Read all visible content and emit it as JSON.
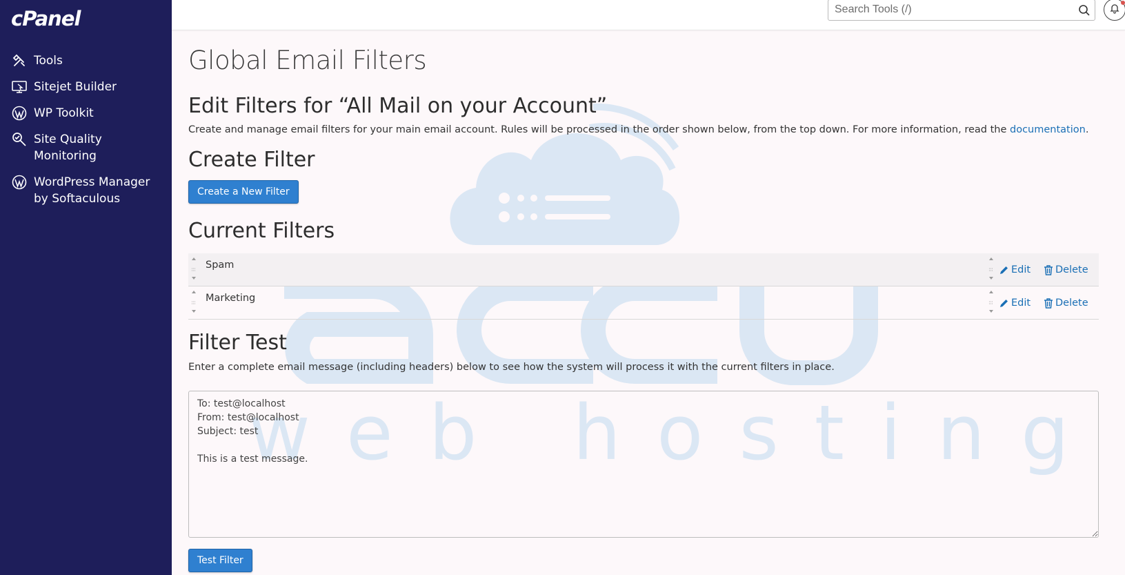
{
  "sidebar": {
    "logo": "cPanel",
    "items": [
      {
        "label": "Tools",
        "icon": "tools-icon"
      },
      {
        "label": "Sitejet Builder",
        "icon": "sitejet-icon"
      },
      {
        "label": "WP Toolkit",
        "icon": "wordpress-icon"
      },
      {
        "label": "Site Quality\nMonitoring",
        "icon": "site-quality-icon"
      },
      {
        "label": "WordPress Manager\nby Softaculous",
        "icon": "wordpress-icon"
      }
    ]
  },
  "topbar": {
    "search_placeholder": "Search Tools (/)"
  },
  "page": {
    "title": "Global Email Filters",
    "edit_heading": "Edit Filters for “All Mail on your Account”",
    "edit_desc": "Create and manage email filters for your main email account. Rules will be processed in the order shown below, from the top down. For more information, read the ",
    "doc_link": "documentation",
    "desc_end": ".",
    "create_heading": "Create Filter",
    "create_button": "Create a New Filter",
    "current_heading": "Current Filters",
    "filters": [
      {
        "name": "Spam",
        "edit": "Edit",
        "delete": "Delete"
      },
      {
        "name": "Marketing",
        "edit": "Edit",
        "delete": "Delete"
      }
    ],
    "test_heading": "Filter Test",
    "test_desc": "Enter a complete email message (including headers) below to see how the system will process it with the current filters in place.",
    "test_message": "To: test@localhost\nFrom: test@localhost\nSubject: test\n\nThis is a test message.",
    "test_button": "Test Filter"
  },
  "watermark": {
    "brand": "accu",
    "tagline": "web hosting"
  },
  "colors": {
    "sidebar_bg": "#1e1e5a",
    "accent": "#2f80d0",
    "link": "#1a6fb5",
    "watermark": "#dbe7f4"
  }
}
